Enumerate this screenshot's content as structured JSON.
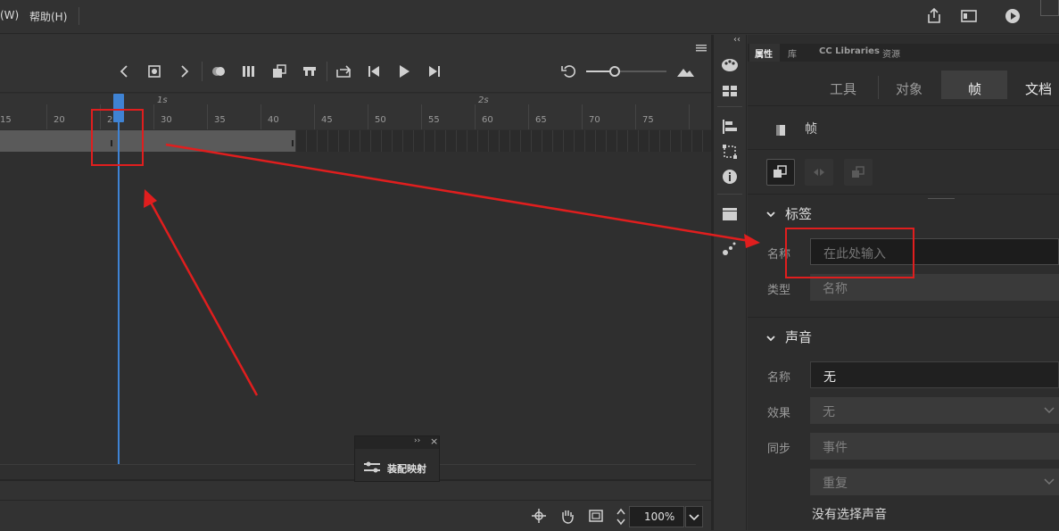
{
  "menubar": {
    "items": [
      {
        "label": "(W)"
      },
      {
        "label": "帮助(H)"
      }
    ],
    "icons": [
      "share-icon",
      "workspace-icon",
      "play-icon"
    ]
  },
  "timeline": {
    "frame_numbers": [
      "15",
      "20",
      "25",
      "30",
      "35",
      "40",
      "45",
      "50",
      "55",
      "60",
      "65",
      "70",
      "75"
    ],
    "second_labels": [
      "1s",
      "2s"
    ],
    "current_frame": 26,
    "playback_icons": [
      "previous-keyframe-icon",
      "insert-keyframe-icon",
      "next-keyframe-icon",
      "onion-skin-icon",
      "edit-multiple-frames-icon",
      "insert-frame-icon",
      "delete-frame-icon",
      "loop-icon",
      "step-back-icon",
      "play-icon",
      "step-forward-icon"
    ]
  },
  "float_panel": {
    "title": "装配映射"
  },
  "status": {
    "zoom": "100%"
  },
  "properties": {
    "tabs": [
      {
        "label": "属性",
        "active": true
      },
      {
        "label": "库",
        "active": false
      },
      {
        "label": "CC Libraries",
        "active": false
      },
      {
        "label": "资源",
        "active": false
      }
    ],
    "segments": [
      {
        "label": "工具",
        "active": false
      },
      {
        "label": "对象",
        "active": false
      },
      {
        "label": "帧",
        "active": true
      },
      {
        "label": "文档",
        "active": false
      }
    ],
    "frame_title": "帧",
    "label_section": {
      "title": "标签",
      "name_label": "名称",
      "name_placeholder": "在此处输入",
      "type_label": "类型",
      "type_value": "名称"
    },
    "sound_section": {
      "title": "声音",
      "name_label": "名称",
      "name_value": "无",
      "effect_label": "效果",
      "effect_value": "无",
      "sync_label": "同步",
      "sync_value": "事件",
      "repeat_value": "重复",
      "no_sound_text": "没有选择声音"
    }
  },
  "colors": {
    "accent": "#3f83d4",
    "annotation": "#e01e1e"
  }
}
